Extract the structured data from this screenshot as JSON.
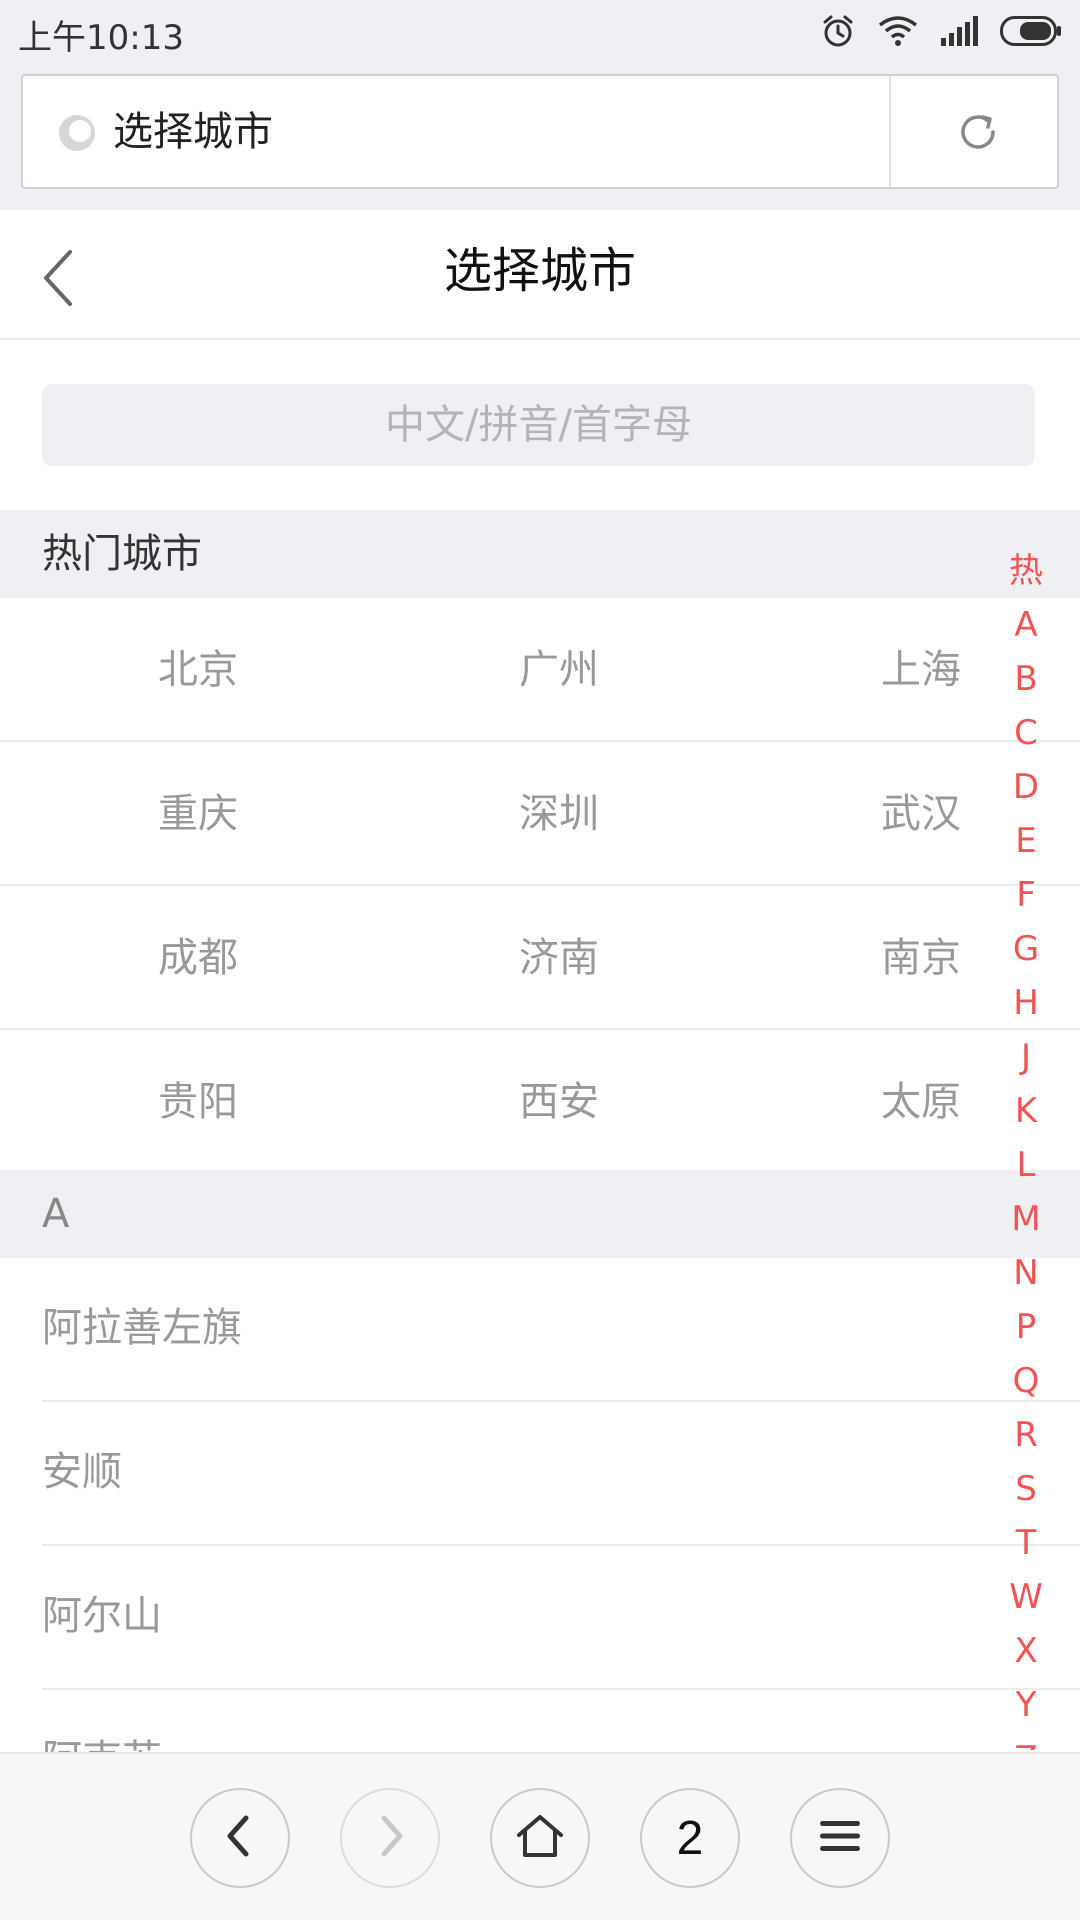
{
  "status_bar": {
    "time": "上午10:13"
  },
  "browser": {
    "url_title": "选择城市"
  },
  "header": {
    "title": "选择城市"
  },
  "search": {
    "placeholder": "中文/拼音/首字母"
  },
  "hot_section": {
    "title": "热门城市",
    "rows": [
      [
        "北京",
        "广州",
        "上海"
      ],
      [
        "重庆",
        "深圳",
        "武汉"
      ],
      [
        "成都",
        "济南",
        "南京"
      ],
      [
        "贵阳",
        "西安",
        "太原"
      ]
    ]
  },
  "section_a": {
    "title": "A",
    "cities": [
      "阿拉善左旗",
      "安顺",
      "阿尔山",
      "阿克苏"
    ]
  },
  "index_bar": [
    "热",
    "A",
    "B",
    "C",
    "D",
    "E",
    "F",
    "G",
    "H",
    "J",
    "K",
    "L",
    "M",
    "N",
    "P",
    "Q",
    "R",
    "S",
    "T",
    "W",
    "X",
    "Y",
    "Z"
  ],
  "bottom_nav": {
    "tab_count": "2"
  },
  "colors": {
    "accent_index": "#f05454",
    "section_bg": "#efeff4",
    "muted_text": "#999999"
  }
}
